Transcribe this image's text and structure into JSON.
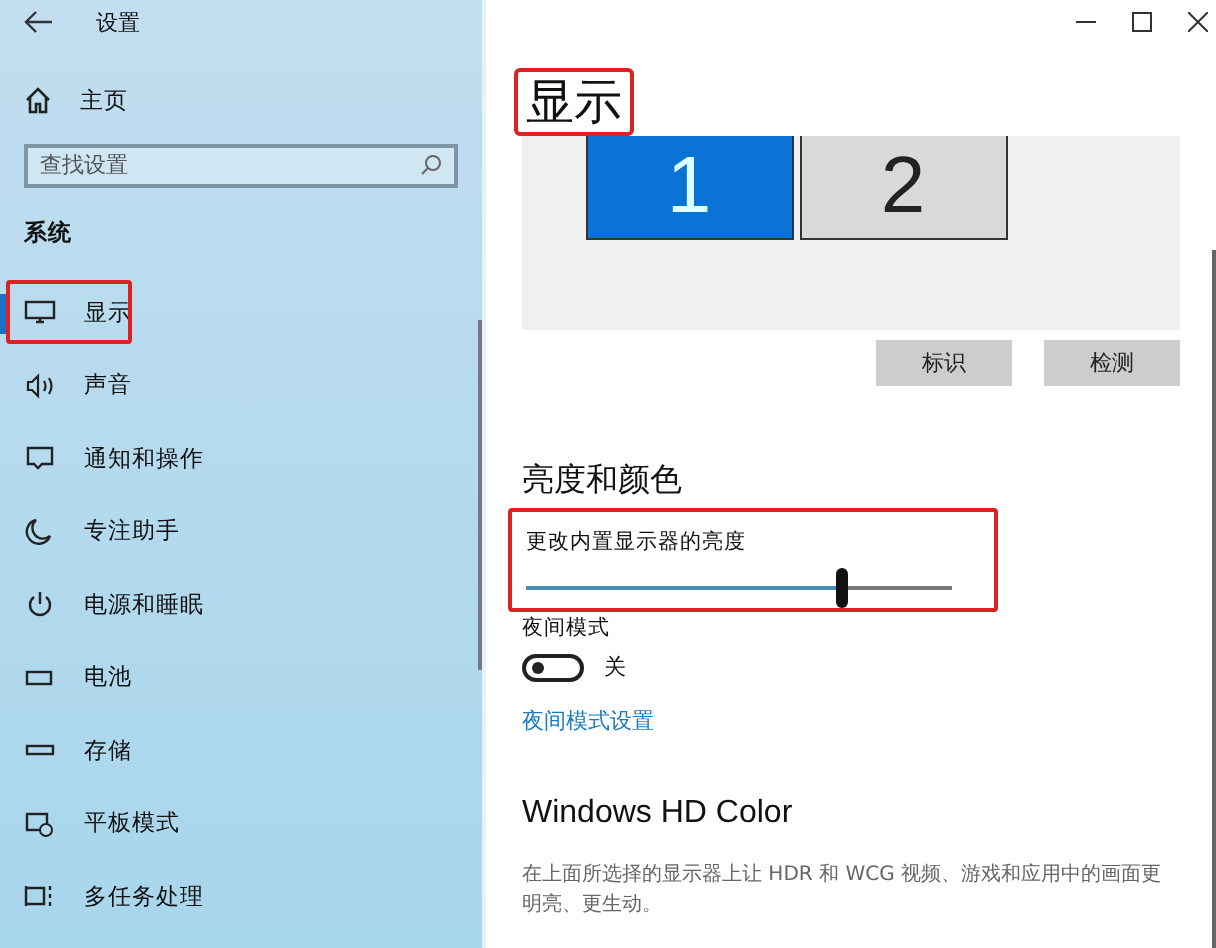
{
  "window": {
    "title": "设置"
  },
  "sidebar": {
    "home": "主页",
    "search": {
      "placeholder": "查找设置"
    },
    "section": "系统",
    "items": [
      {
        "label": "显示",
        "selected": true,
        "highlighted": true
      },
      {
        "label": "声音",
        "selected": false,
        "highlighted": false
      },
      {
        "label": "通知和操作",
        "selected": false,
        "highlighted": false
      },
      {
        "label": "专注助手",
        "selected": false,
        "highlighted": false
      },
      {
        "label": "电源和睡眠",
        "selected": false,
        "highlighted": false
      },
      {
        "label": "电池",
        "selected": false,
        "highlighted": false
      },
      {
        "label": "存储",
        "selected": false,
        "highlighted": false
      },
      {
        "label": "平板模式",
        "selected": false,
        "highlighted": false
      },
      {
        "label": "多任务处理",
        "selected": false,
        "highlighted": false
      }
    ]
  },
  "page": {
    "title": "显示",
    "title_highlighted": true,
    "monitors": [
      {
        "label": "1",
        "selected": true
      },
      {
        "label": "2",
        "selected": false
      }
    ],
    "buttons": [
      "标识",
      "检测"
    ],
    "brightness": {
      "heading": "亮度和颜色",
      "label": "更改内置显示器的亮度",
      "level": 0.74,
      "highlighted": true
    },
    "night_light": {
      "label": "夜间模式",
      "on": false,
      "state": "关",
      "link": "夜间模式设置"
    },
    "hd_color": {
      "heading": "Windows HD Color",
      "description": "在上面所选择的显示器上让 HDR 和 WCG 视频、游戏和应用中的画面更明亮、更生动。"
    }
  }
}
